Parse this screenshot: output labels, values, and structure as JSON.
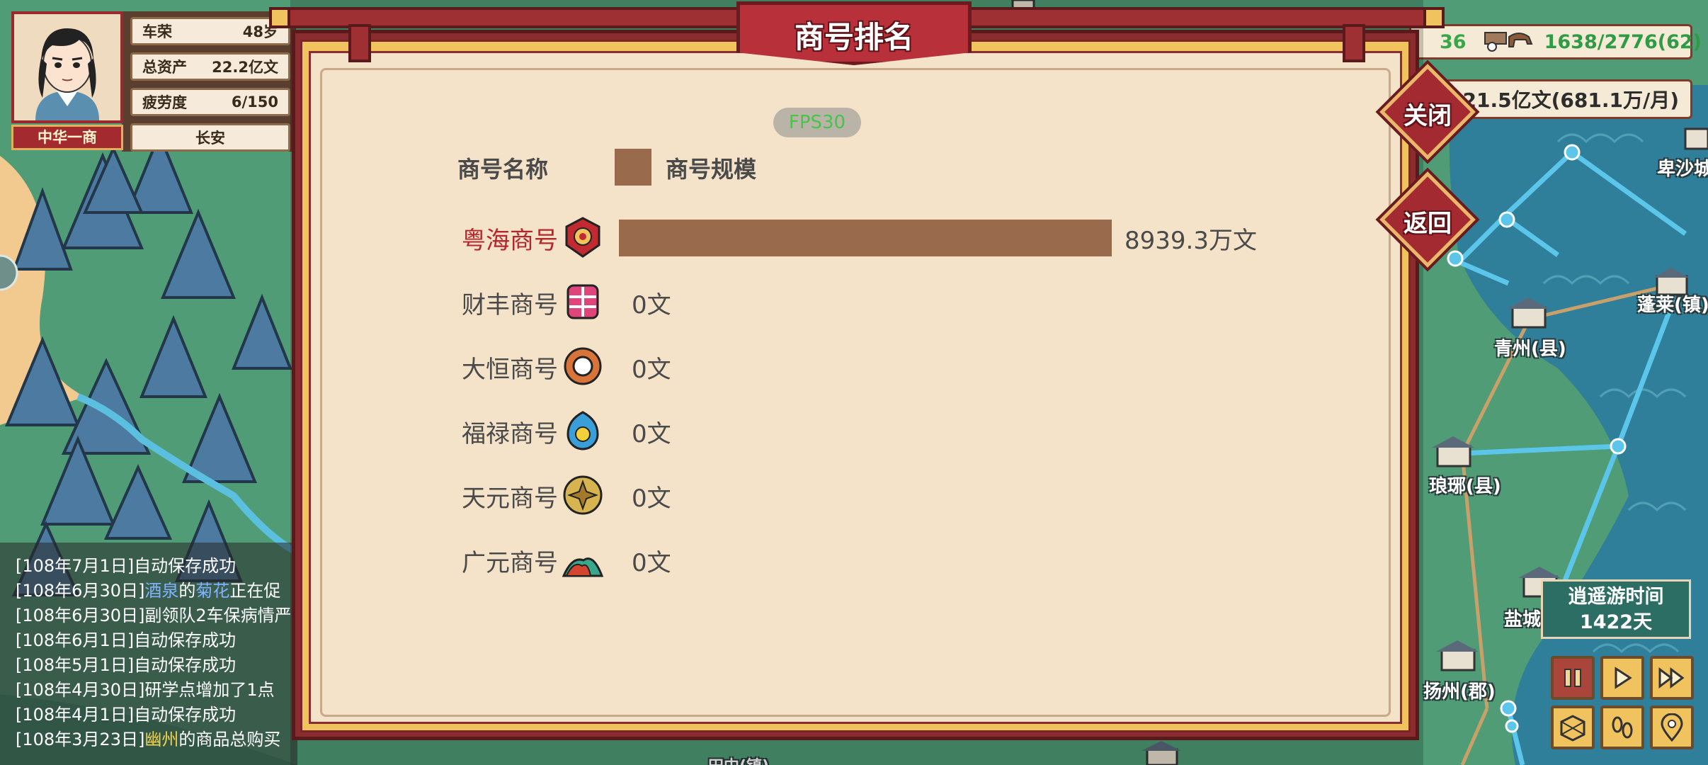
{
  "player": {
    "name": "车荣",
    "name_value": "48岁",
    "assets_label": "总资产",
    "assets_value": "22.2亿文",
    "fatigue_label": "疲劳度",
    "fatigue_value": "6/150",
    "title": "中华一商",
    "city": "长安"
  },
  "resources": {
    "left_partial": "36",
    "caravan": "1638/2776(62)",
    "money": "21.5亿文(681.1万/月)"
  },
  "dialog": {
    "title": "商号排名",
    "fps": "FPS30",
    "col_name": "商号名称",
    "col_scale": "商号规模",
    "close_label": "关闭",
    "back_label": "返回"
  },
  "chart_data": {
    "type": "bar",
    "orientation": "horizontal",
    "categories": [
      "粤海商号",
      "财丰商号",
      "大恒商号",
      "福禄商号",
      "天元商号",
      "广元商号"
    ],
    "values": [
      8939.3,
      0,
      0,
      0,
      0,
      0
    ],
    "value_labels": [
      "8939.3万文",
      "0文",
      "0文",
      "0文",
      "0文",
      "0文"
    ],
    "unit": "万文",
    "legend": [
      "商号规模"
    ],
    "colors": {
      "bar": "#9a6a4c",
      "highlight_text": "#b3262c",
      "text": "#4a4a4a"
    }
  },
  "rank_icons": [
    "seal-icon",
    "coin-ribbon-icon",
    "ring-icon",
    "blue-gem-icon",
    "gold-medallion-icon",
    "mountain-icon"
  ],
  "log": {
    "lines": [
      {
        "date": "[108年7月1日]",
        "text": "自动保存成功"
      },
      {
        "date": "[108年6月30日]",
        "pre": "",
        "hl1": "酒泉",
        "mid": "的",
        "hl2": "菊花",
        "post": "正在促"
      },
      {
        "date": "[108年6月30日]",
        "text": "副领队2车保病情严"
      },
      {
        "date": "[108年6月1日]",
        "text": "自动保存成功"
      },
      {
        "date": "[108年5月1日]",
        "text": "自动保存成功"
      },
      {
        "date": "[108年4月30日]",
        "text": "研学点增加了1点"
      },
      {
        "date": "[108年4月1日]",
        "text": "自动保存成功"
      },
      {
        "date": "[108年3月23日]",
        "hl3": "幽州",
        "post2": "的商品总购买"
      }
    ]
  },
  "map": {
    "towns": [
      "卑沙城",
      "蓬莱(镇)",
      "青州(县)",
      "琅琊(县)",
      "盐城",
      "扬州(郡)",
      "田中(镇)"
    ]
  },
  "time": {
    "label": "逍遥游时间",
    "value": "1422天"
  },
  "controls": [
    "pause-icon",
    "play-icon",
    "fast-forward-icon",
    "map-icon",
    "footprints-icon",
    "location-pin-icon"
  ]
}
